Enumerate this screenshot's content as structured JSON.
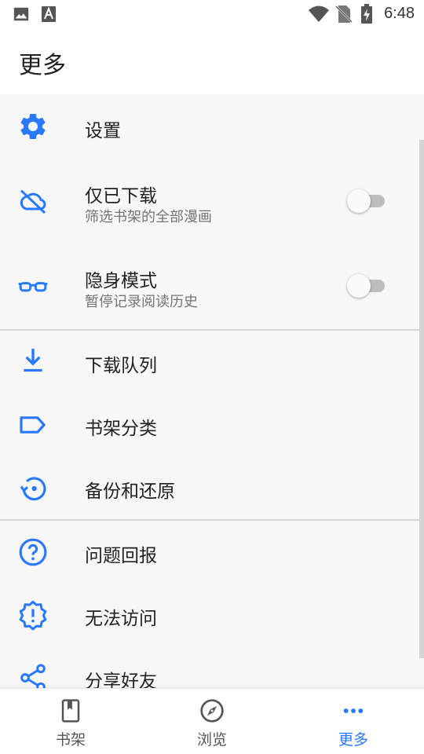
{
  "status_bar": {
    "time": "6:48",
    "icons": [
      "image-icon",
      "text-a-icon",
      "wifi-icon",
      "no-sim-icon",
      "battery-charging-icon"
    ]
  },
  "header": {
    "title": "更多"
  },
  "menu": {
    "settings": {
      "label": "设置",
      "icon": "gear-icon"
    },
    "downloaded_only": {
      "label": "仅已下载",
      "sublabel": "筛选书架的全部漫画",
      "icon": "cloud-off-icon",
      "enabled": false
    },
    "incognito": {
      "label": "隐身模式",
      "sublabel": "暂停记录阅读历史",
      "icon": "glasses-icon",
      "enabled": false
    },
    "download_queue": {
      "label": "下载队列",
      "icon": "download-icon"
    },
    "categories": {
      "label": "书架分类",
      "icon": "label-icon"
    },
    "backup_restore": {
      "label": "备份和还原",
      "icon": "restore-icon"
    },
    "report_issue": {
      "label": "问题回报",
      "icon": "help-icon"
    },
    "cannot_access": {
      "label": "无法访问",
      "icon": "alert-badge-icon"
    },
    "share": {
      "label": "分享好友",
      "icon": "share-icon"
    }
  },
  "bottom_nav": {
    "library": {
      "label": "书架",
      "icon": "bookmark-book-icon"
    },
    "browse": {
      "label": "浏览",
      "icon": "compass-icon"
    },
    "more": {
      "label": "更多",
      "icon": "more-dots-icon",
      "active": true
    }
  },
  "colors": {
    "accent": "#2979ff",
    "background": "#f7f7f7",
    "text": "#212121",
    "subtext": "#757575"
  }
}
